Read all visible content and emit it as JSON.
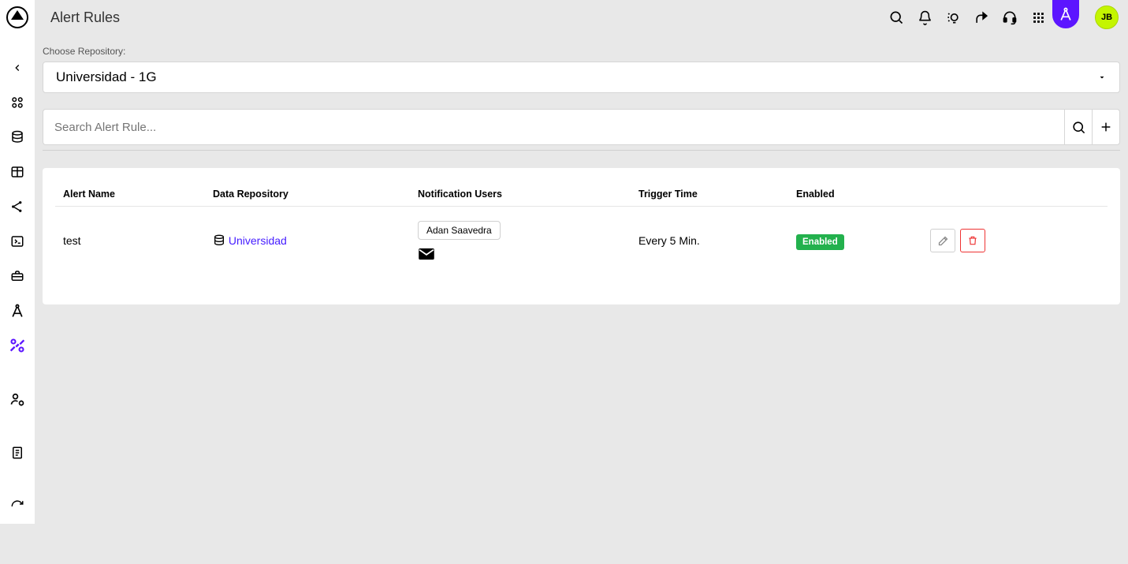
{
  "header": {
    "title": "Alert Rules",
    "avatar_initials": "JB"
  },
  "repo": {
    "label": "Choose Repository:",
    "selected": "Universidad - 1G"
  },
  "search": {
    "placeholder": "Search Alert Rule..."
  },
  "table": {
    "columns": [
      "Alert Name",
      "Data Repository",
      "Notification Users",
      "Trigger Time",
      "Enabled"
    ],
    "rows": [
      {
        "name": "test",
        "repository": "Universidad",
        "users": [
          "Adan Saavedra"
        ],
        "trigger": "Every 5 Min.",
        "enabled_label": "Enabled"
      }
    ]
  },
  "colors": {
    "accent": "#5c15ff",
    "link": "#461eff",
    "success": "#23b14d",
    "avatar_bg": "#c4f500"
  }
}
